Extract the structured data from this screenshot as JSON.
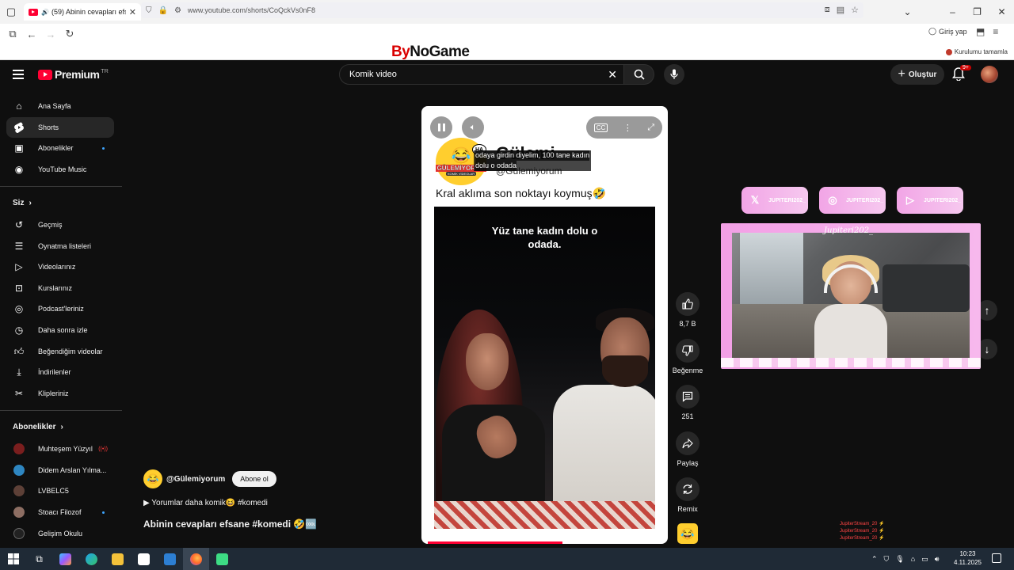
{
  "browser": {
    "tab_title": "(59) Abinin cevapları efsane",
    "url": "www.youtube.com/shorts/CoQckVs0nF8",
    "sign_in": "Giriş yap",
    "setup_done": "Kurulumu tamamla"
  },
  "overlay_logo": {
    "by": "By",
    "name": "NoGame"
  },
  "header": {
    "logo_text": "Premium",
    "region": "TR",
    "search_value": "Komik video",
    "create_label": "Oluştur",
    "notif_count": "9+"
  },
  "sidebar": {
    "main": [
      {
        "label": "Ana Sayfa",
        "icon": "home-icon"
      },
      {
        "label": "Shorts",
        "icon": "shorts-icon"
      },
      {
        "label": "Abonelikler",
        "icon": "subscriptions-icon"
      },
      {
        "label": "YouTube Music",
        "icon": "music-icon"
      }
    ],
    "you_heading": "Siz",
    "you": [
      {
        "label": "Geçmiş",
        "icon": "history-icon"
      },
      {
        "label": "Oynatma listeleri",
        "icon": "playlists-icon"
      },
      {
        "label": "Videolarınız",
        "icon": "your-videos-icon"
      },
      {
        "label": "Kurslarınız",
        "icon": "courses-icon"
      },
      {
        "label": "Podcast'leriniz",
        "icon": "podcasts-icon"
      },
      {
        "label": "Daha sonra izle",
        "icon": "watch-later-icon"
      },
      {
        "label": "Beğendiğim videolar",
        "icon": "liked-videos-icon"
      },
      {
        "label": "İndirilenler",
        "icon": "downloads-icon"
      },
      {
        "label": "Klipleriniz",
        "icon": "clips-icon"
      }
    ],
    "subs_heading": "Abonelikler",
    "subs": [
      {
        "label": "Muhteşem Yüzyıl",
        "color": "#7a1e1e"
      },
      {
        "label": "Didem Arslan Yılma...",
        "color": "#2e86c1"
      },
      {
        "label": "LVBELC5",
        "color": "#5d4037"
      },
      {
        "label": "Stoacı Filozof",
        "color": "#8d6e63"
      },
      {
        "label": "Gelişim Okulu",
        "color": "#222222"
      }
    ]
  },
  "short": {
    "channel_big_name": "Gülemi",
    "channel_handle_small": "@Gülemiyorum",
    "logo_label": "GÜLEMİYORUM",
    "logo_sub": "KOMİK VİDEOLAR",
    "logo_bubble": "HA",
    "caption_line1": "odaya girdin diyelim, 100 tane kadın",
    "caption_line2": "dolu o odada",
    "overlay_line": "Kral aklıma son noktayı koymuş🤣",
    "video_text_line1": "Yüz tane kadın dolu o",
    "video_text_line2": "odada."
  },
  "actions": {
    "like_count": "8,7 B",
    "dislike_label": "Beğenme",
    "comment_count": "251",
    "share_label": "Paylaş",
    "remix_label": "Remix"
  },
  "info": {
    "channel": "@Gülemiyorum",
    "subscribe": "Abone ol",
    "comments_link": "▶ Yorumlar daha komik😆 #komedi",
    "title": "Abinin cevapları efsane #komedi 🤣🆒"
  },
  "stream": {
    "social_handle": "JUPITERI202_",
    "cam_label": "Jupiteri202_",
    "footer_lines": [
      "JupiterStream_20 ⚡",
      "JupiterStream_20 ⚡",
      "JupiterStream_20 ⚡"
    ]
  },
  "taskbar": {
    "time": "10:23",
    "date": "4.11.2025"
  }
}
